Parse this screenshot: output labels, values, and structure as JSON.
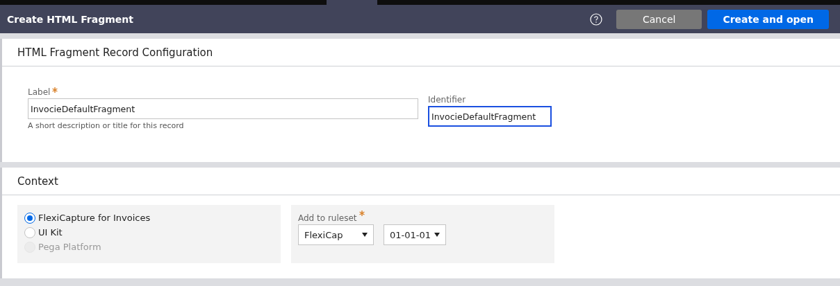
{
  "header": {
    "title": "Create HTML Fragment",
    "buttons": [
      {
        "label": "Cancel",
        "kind": "secondary"
      },
      {
        "label": "Create and open",
        "kind": "primary"
      }
    ]
  },
  "configuration": {
    "title": "HTML Fragment Record Configuration",
    "label_field": {
      "label": "Label",
      "required": true,
      "value": "InvocieDefaultFragment",
      "hint": "A short description or title for this record"
    },
    "identifier_field": {
      "label": "Identifier",
      "value": "InvocieDefaultFragment",
      "focused": true
    }
  },
  "context": {
    "title": "Context",
    "options": [
      {
        "label": "FlexiCapture for Invoices",
        "selected": true,
        "disabled": false
      },
      {
        "label": "UI Kit",
        "selected": false,
        "disabled": false
      },
      {
        "label": "Pega Platform",
        "selected": false,
        "disabled": true
      }
    ],
    "ruleset": {
      "label": "Add to ruleset",
      "required": true,
      "name": "FlexiCap",
      "version": "01-01-01"
    }
  }
}
